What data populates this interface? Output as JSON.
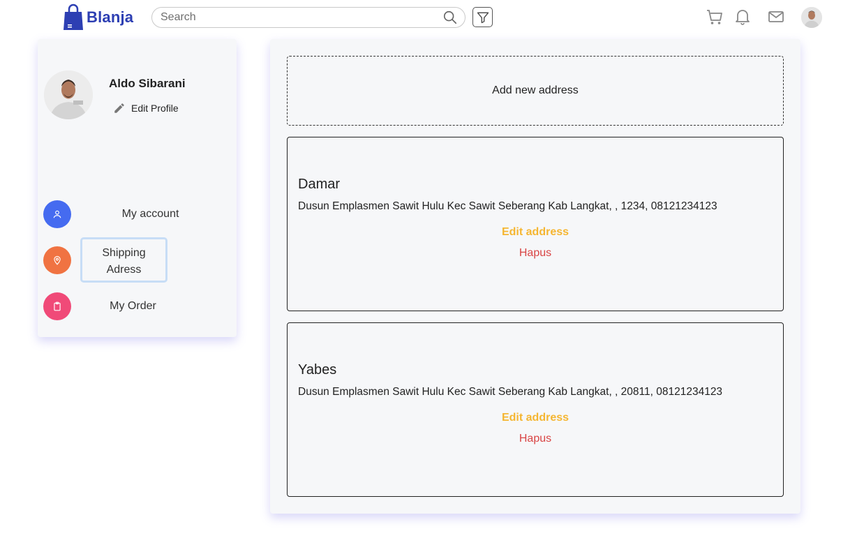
{
  "header": {
    "brand": "Blanja",
    "search": {
      "placeholder": "Search",
      "value": ""
    },
    "icons": [
      "search-icon",
      "filter-icon",
      "cart-icon",
      "bell-icon",
      "mail-icon",
      "avatar"
    ]
  },
  "sidebar": {
    "profile": {
      "name": "Aldo Sibarani",
      "edit_label": "Edit Profile"
    },
    "menu": [
      {
        "label": "My account",
        "icon": "user-icon",
        "color": "#456bf0"
      },
      {
        "label": "Shipping Adress",
        "icon": "location-pin-icon",
        "color": "#f07342",
        "active": true
      },
      {
        "label": "My Order",
        "icon": "clipboard-icon",
        "color": "#f04a78"
      }
    ]
  },
  "main": {
    "add_address_label": "Add new address",
    "addresses": [
      {
        "name": "Damar",
        "address": "Dusun Emplasmen Sawit Hulu Kec Sawit Seberang Kab Langkat, , 1234, 08121234123",
        "edit_label": "Edit address",
        "delete_label": "Hapus"
      },
      {
        "name": "Yabes",
        "address": "Dusun Emplasmen Sawit Hulu Kec Sawit Seberang Kab Langkat, , 20811, 08121234123",
        "edit_label": "Edit address",
        "delete_label": "Hapus"
      }
    ]
  },
  "colors": {
    "brand": "#2d3fb3",
    "edit": "#f5b632",
    "delete": "#d94545"
  }
}
